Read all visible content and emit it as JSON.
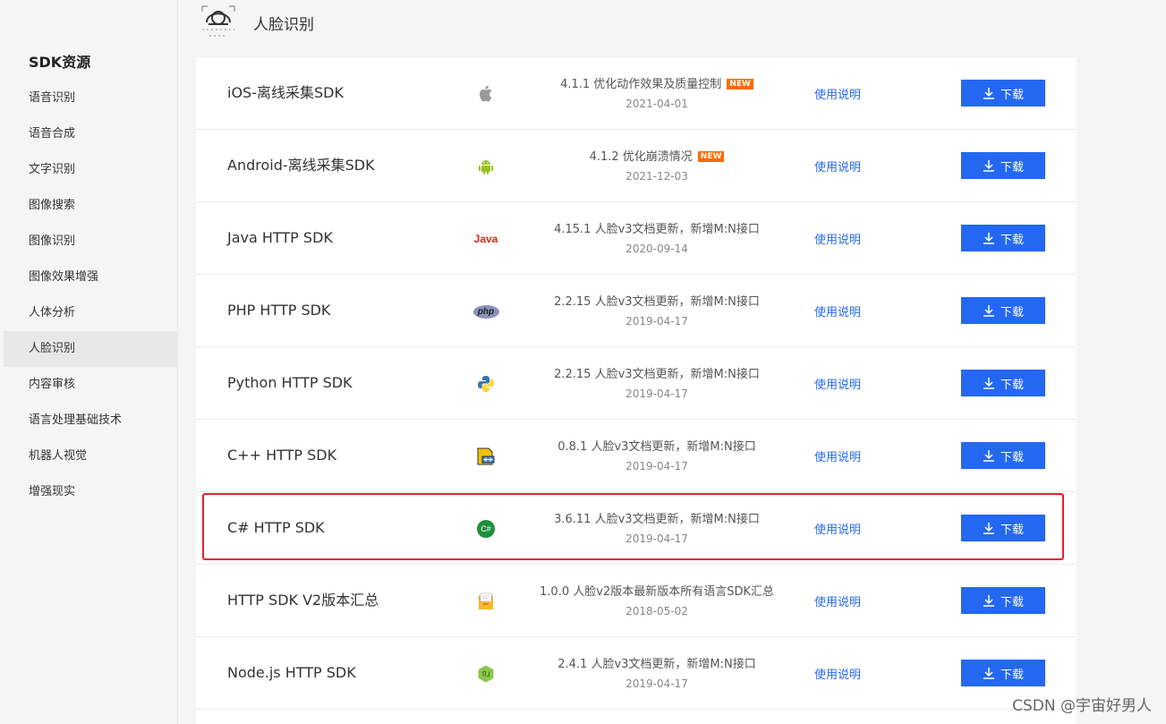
{
  "sidebar": {
    "title": "SDK资源",
    "items": [
      {
        "label": "语音识别"
      },
      {
        "label": "语音合成"
      },
      {
        "label": "文字识别"
      },
      {
        "label": "图像搜索"
      },
      {
        "label": "图像识别"
      },
      {
        "label": "图像效果增强"
      },
      {
        "label": "人体分析"
      },
      {
        "label": "人脸识别",
        "active": true
      },
      {
        "label": "内容审核"
      },
      {
        "label": "语言处理基础技术"
      },
      {
        "label": "机器人视觉"
      },
      {
        "label": "增强现实"
      }
    ]
  },
  "section": {
    "title": "人脸识别",
    "icon": "face-recognition-icon"
  },
  "rows": [
    {
      "name": "iOS-离线采集SDK",
      "icon": "apple-icon",
      "desc": "4.1.1 优化动作效果及质量控制",
      "badge": "NEW",
      "date": "2021-04-01",
      "doc": "使用说明",
      "download": "下载"
    },
    {
      "name": "Android-离线采集SDK",
      "icon": "android-icon",
      "desc": "4.1.2 优化崩溃情况",
      "badge": "NEW",
      "date": "2021-12-03",
      "doc": "使用说明",
      "download": "下载"
    },
    {
      "name": "Java HTTP SDK",
      "icon": "java-icon",
      "icon_text": "Java",
      "desc": "4.15.1 人脸v3文档更新，新增M:N接口",
      "date": "2020-09-14",
      "doc": "使用说明",
      "download": "下载"
    },
    {
      "name": "PHP HTTP SDK",
      "icon": "php-icon",
      "icon_text": "php",
      "desc": "2.2.15 人脸v3文档更新，新增M:N接口",
      "date": "2019-04-17",
      "doc": "使用说明",
      "download": "下载"
    },
    {
      "name": "Python HTTP SDK",
      "icon": "python-icon",
      "desc": "2.2.15 人脸v3文档更新，新增M:N接口",
      "date": "2019-04-17",
      "doc": "使用说明",
      "download": "下载"
    },
    {
      "name": "C++ HTTP SDK",
      "icon": "cpp-icon",
      "desc": "0.8.1 人脸v3文档更新，新增M:N接口",
      "date": "2019-04-17",
      "doc": "使用说明",
      "download": "下载"
    },
    {
      "name": "C# HTTP SDK",
      "icon": "csharp-icon",
      "icon_text": "C#",
      "desc": "3.6.11 人脸v3文档更新，新增M:N接口",
      "date": "2019-04-17",
      "doc": "使用说明",
      "download": "下载"
    },
    {
      "name": "HTTP SDK V2版本汇总",
      "icon": "archive-icon",
      "desc": "1.0.0 人脸v2版本最新版本所有语言SDK汇总",
      "date": "2018-05-02",
      "doc": "使用说明",
      "download": "下载"
    },
    {
      "name": "Node.js HTTP SDK",
      "icon": "nodejs-icon",
      "desc": "2.4.1 人脸v3文档更新，新增M:N接口",
      "date": "2019-04-17",
      "doc": "使用说明",
      "download": "下载"
    }
  ],
  "watermark": "CSDN @宇宙好男人",
  "colors": {
    "accent": "#2468f2",
    "highlight": "#e8202a",
    "badge": "#ff6a00"
  }
}
